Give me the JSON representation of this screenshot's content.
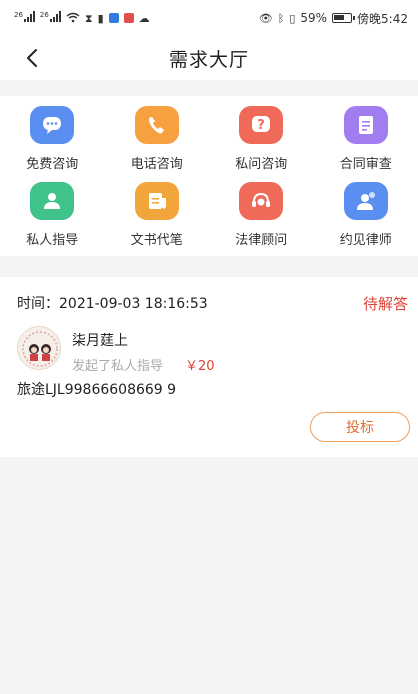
{
  "status_bar": {
    "time": "傍晚5:42",
    "battery": "59%",
    "net1": "26",
    "net2": "26"
  },
  "header": {
    "title": "需求大厅"
  },
  "categories": [
    {
      "label": "免费咨询",
      "icon": "chat-bubble-icon",
      "color": "#5a8ef0"
    },
    {
      "label": "电话咨询",
      "icon": "phone-icon",
      "color": "#f6a040"
    },
    {
      "label": "私问咨询",
      "icon": "question-icon",
      "color": "#f06a5a"
    },
    {
      "label": "合同审查",
      "icon": "document-icon",
      "color": "#a17ef0"
    },
    {
      "label": "私人指导",
      "icon": "person-icon",
      "color": "#3fc38a"
    },
    {
      "label": "文书代笔",
      "icon": "writing-icon",
      "color": "#f2a53a"
    },
    {
      "label": "法律顾问",
      "icon": "headset-icon",
      "color": "#f06a5a"
    },
    {
      "label": "约见律师",
      "icon": "lawyer-icon",
      "color": "#5a8ef0"
    }
  ],
  "request": {
    "time_label": "时间：2021-09-03 18:16:53",
    "status": "待解答",
    "user_name": "柒月莛上",
    "description": "发起了私人指导",
    "price": "￥20",
    "content": "旅途LJL99866608669  9",
    "bid_label": "投标"
  }
}
